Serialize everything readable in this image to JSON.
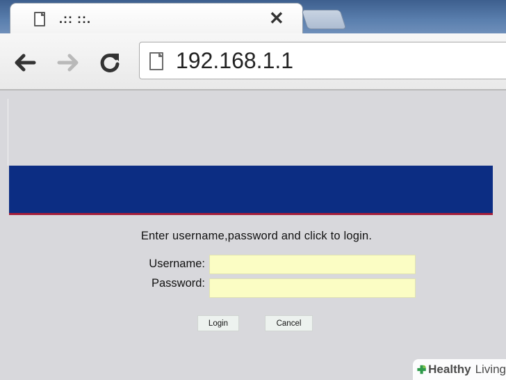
{
  "browser": {
    "tab_title": ".:: ::.",
    "tab_close": "✕",
    "url": "192.168.1.1"
  },
  "page": {
    "prompt": "Enter username,password and click to login.",
    "username_label": "Username:",
    "username_value": "",
    "password_label": "Password:",
    "password_value": "",
    "login_label": "Login",
    "cancel_label": "Cancel",
    "banner_color": "#0c2d83",
    "banner_stripe_color": "#a51e3a",
    "field_color": "#fbfdc4"
  },
  "watermark": {
    "brand_bold": "Healthy",
    "brand_light": "Living",
    "icon": "plus-leaf-icon",
    "color": "#2e9a4a"
  }
}
